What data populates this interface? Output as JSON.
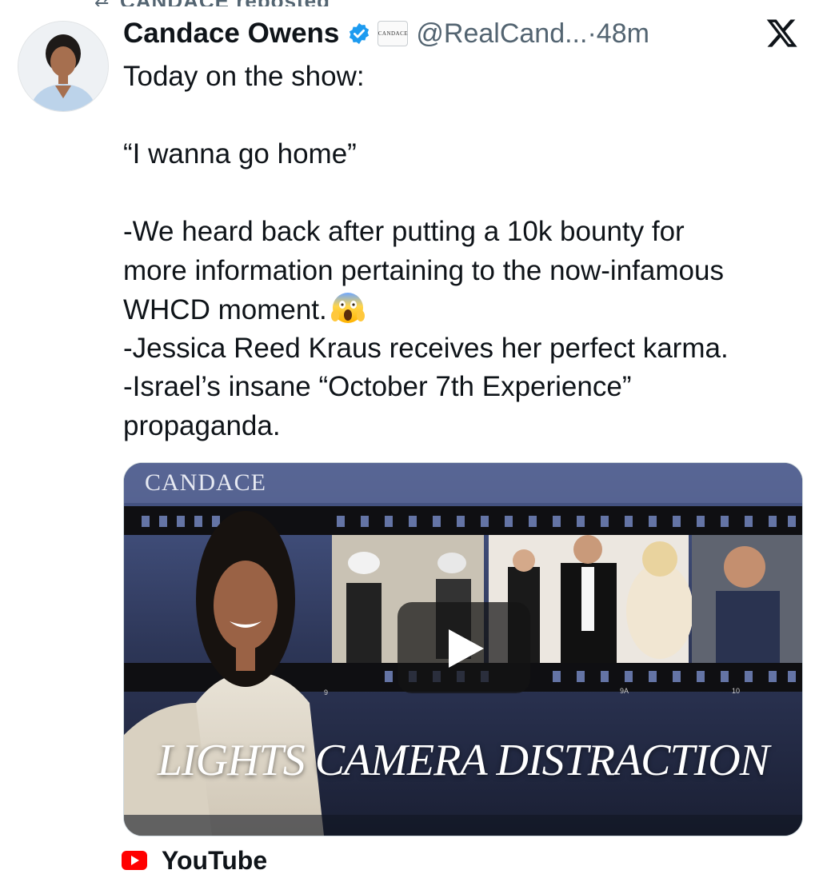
{
  "repost": {
    "text": "CANDACE reposted"
  },
  "tweet": {
    "author_name": "Candace Owens",
    "affiliate_badge": "CANDACE",
    "handle": "@RealCand...",
    "time_separator": "·",
    "time": "48m",
    "text_lines": [
      "Today on the show:",
      "",
      "“I wanna go home”",
      "",
      "-We heard back after putting a 10k bounty for",
      "more information pertaining to the now-infamous",
      "WHCD moment.",
      "-Jessica Reed Kraus receives her perfect karma.",
      "-Israel’s insane “October 7th Experience”",
      "propaganda."
    ],
    "emoji": "screaming-face-emoji"
  },
  "media": {
    "brand_text": "CANDACE",
    "title_text": "LIGHTS CAMERA DISTRACTION",
    "film_frame_labels": [
      "9",
      "9A",
      "10"
    ],
    "source_label": "YouTube"
  },
  "colors": {
    "text_primary": "#0f1419",
    "text_secondary": "#536471",
    "verified_blue": "#1d9bf0",
    "youtube_red": "#ff0000"
  }
}
